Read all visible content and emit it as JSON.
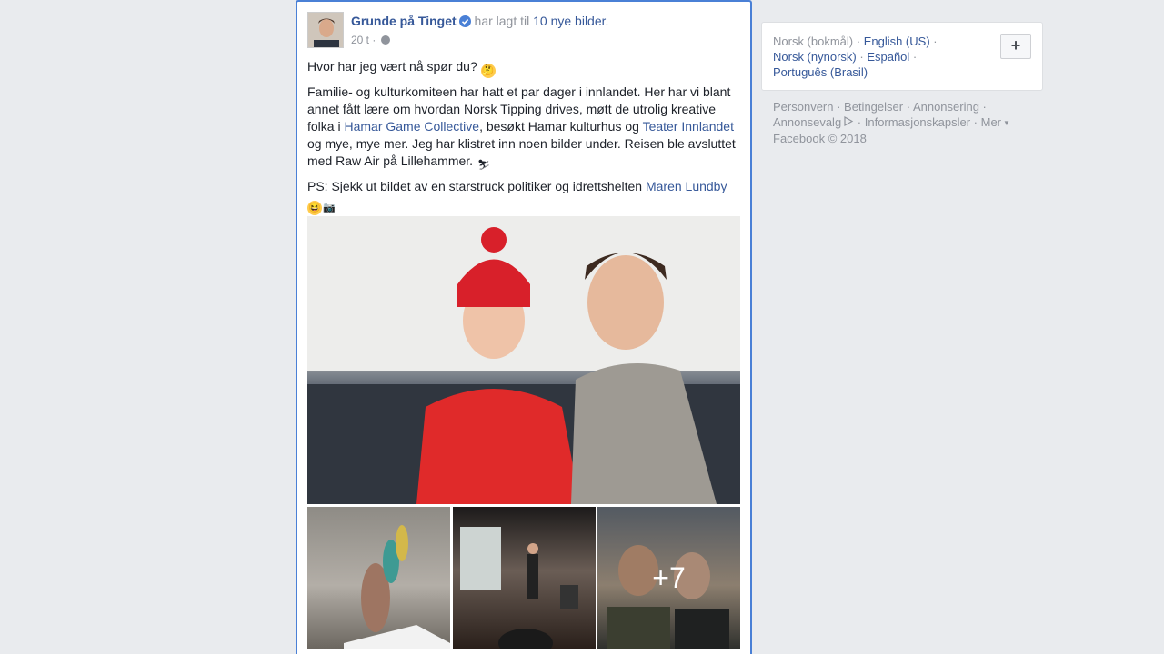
{
  "post": {
    "author": "Grunde på Tinget",
    "action_prefix": " har lagt til ",
    "action_link": "10 nye bilder",
    "action_suffix": ".",
    "time": "20 t",
    "time_sep": " · ",
    "line1": "Hvor har jeg vært nå spør du?",
    "para2_a": "Familie- og kulturkomiteen har hatt et par dager i innlandet. Her har vi blant annet fått lære om hvordan Norsk Tipping drives, møtt de utrolig kreative folka i ",
    "link_hamar": "Hamar Game Collective",
    "para2_b": ", besøkt Hamar kulturhus og ",
    "link_teater": "Teater Innlandet",
    "para2_c": " og mye, mye mer. Jeg har klistret inn noen bilder under. Reisen ble avsluttet med Raw Air på Lillehammer.",
    "para3_a": "PS: Sjekk ut bildet av en starstruck politiker og idrettshelten ",
    "link_maren": "Maren Lundby",
    "more_count": "+7"
  },
  "languages": {
    "current": "Norsk (bokmål)",
    "sep": " · ",
    "options": [
      "English (US)",
      "Norsk (nynorsk)",
      "Español",
      "Português (Brasil)"
    ],
    "add_label": "+"
  },
  "footer": {
    "links": [
      "Personvern",
      "Betingelser",
      "Annonsering",
      "Annonsevalg",
      "Informasjonskapsler",
      "Mer"
    ],
    "copyright": "Facebook © 2018"
  },
  "colors": {
    "link": "#365899",
    "secondary": "#90949c",
    "focus_border": "#4a80d6"
  }
}
